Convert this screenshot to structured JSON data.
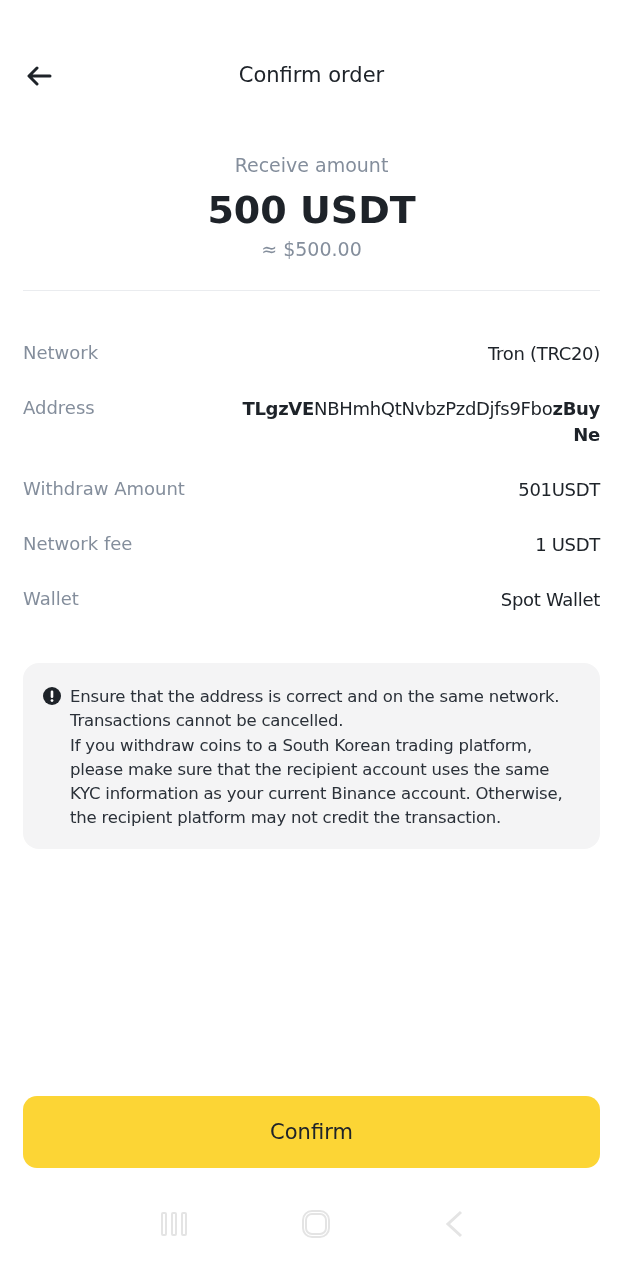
{
  "header": {
    "title": "Confirm order"
  },
  "summary": {
    "label": "Receive amount",
    "amount": "500 USDT",
    "approx": "≈ $500.00"
  },
  "details": [
    {
      "label": "Network",
      "value": "Tron (TRC20)"
    },
    {
      "label": "Address",
      "value": "**TLgzVE**NBHmhQtNvbzPzdDjfs9Fbo**zBuyNe**"
    },
    {
      "label": "Withdraw Amount",
      "value": "501USDT"
    },
    {
      "label": "Network fee",
      "value": "1 USDT"
    },
    {
      "label": "Wallet",
      "value": "Spot Wallet"
    }
  ],
  "notice": [
    "Ensure that the address is correct and on the same network. Transactions cannot be cancelled.",
    "If you withdraw coins to a South Korean trading platform, please make sure that the recipient account uses the same KYC information as your current Binance account. Otherwise, the recipient platform may not credit the transaction."
  ],
  "confirm_button": "Confirm"
}
